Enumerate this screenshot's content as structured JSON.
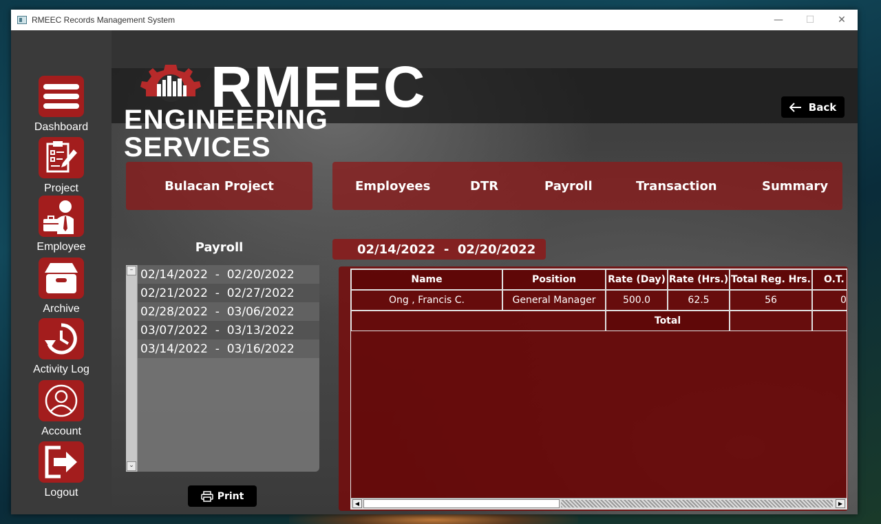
{
  "window": {
    "title": "RMEEC Records Management System",
    "min": "—",
    "max": "☐",
    "close": "✕"
  },
  "sidebar": {
    "items": [
      {
        "label": "Dashboard"
      },
      {
        "label": "Project"
      },
      {
        "label": "Employee"
      },
      {
        "label": "Archive"
      },
      {
        "label": "Activity Log"
      },
      {
        "label": "Account"
      },
      {
        "label": "Logout"
      }
    ]
  },
  "logo": {
    "word": "RMEEC",
    "sub": "ENGINEERING SERVICES"
  },
  "header": {
    "back_label": "Back"
  },
  "project": {
    "name": "Bulacan Project"
  },
  "tabs": [
    {
      "label": "Employees"
    },
    {
      "label": "DTR"
    },
    {
      "label": "Payroll"
    },
    {
      "label": "Transaction"
    },
    {
      "label": "Summary"
    }
  ],
  "payroll": {
    "title": "Payroll",
    "periods": [
      "02/14/2022  -  02/20/2022",
      "02/21/2022  -  02/27/2022",
      "02/28/2022  -  03/06/2022",
      "03/07/2022  -  03/13/2022",
      "03/14/2022  -  03/16/2022"
    ],
    "print_label": "Print"
  },
  "selected_range": "02/14/2022  -  02/20/2022",
  "table": {
    "headers": [
      "Name",
      "Position",
      "Rate (Day)",
      "Rate (Hrs.)",
      "Total Reg. Hrs.",
      "O.T. H"
    ],
    "rows": [
      [
        "Ong , Francis C.",
        "General Manager",
        "500.0",
        "62.5",
        "56",
        "0"
      ]
    ],
    "total_label": "Total"
  },
  "colors": {
    "accent": "#a31d1d",
    "panel": "#8c1919",
    "sidebar": "#3a3a3a"
  }
}
